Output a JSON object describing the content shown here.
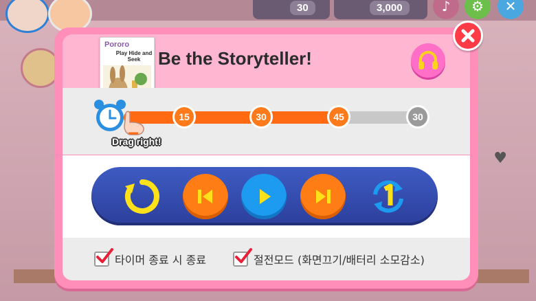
{
  "background": {
    "counter_left": "30",
    "counter_right": "3,000"
  },
  "dialog": {
    "book": {
      "brand": "Pororo",
      "title": "Play Hide and Seek"
    },
    "title": "Be the Storyteller!",
    "timer": {
      "markers": [
        "15",
        "30",
        "45",
        "30"
      ],
      "hint": "Drag right!",
      "progress_fraction": 0.72
    },
    "controls": {
      "items": [
        "replay",
        "previous",
        "play",
        "next",
        "repeat-one"
      ]
    },
    "options": [
      {
        "label": "타이머 종료 시 종료",
        "checked": true
      },
      {
        "label": "절전모드 (화면끄기/배터리 소모감소)",
        "checked": true
      }
    ],
    "colors": {
      "accent": "#ff8fb9",
      "progress": "#ff6a12",
      "controls_bar": "#2c3f9b",
      "close": "#ff3b45"
    }
  }
}
